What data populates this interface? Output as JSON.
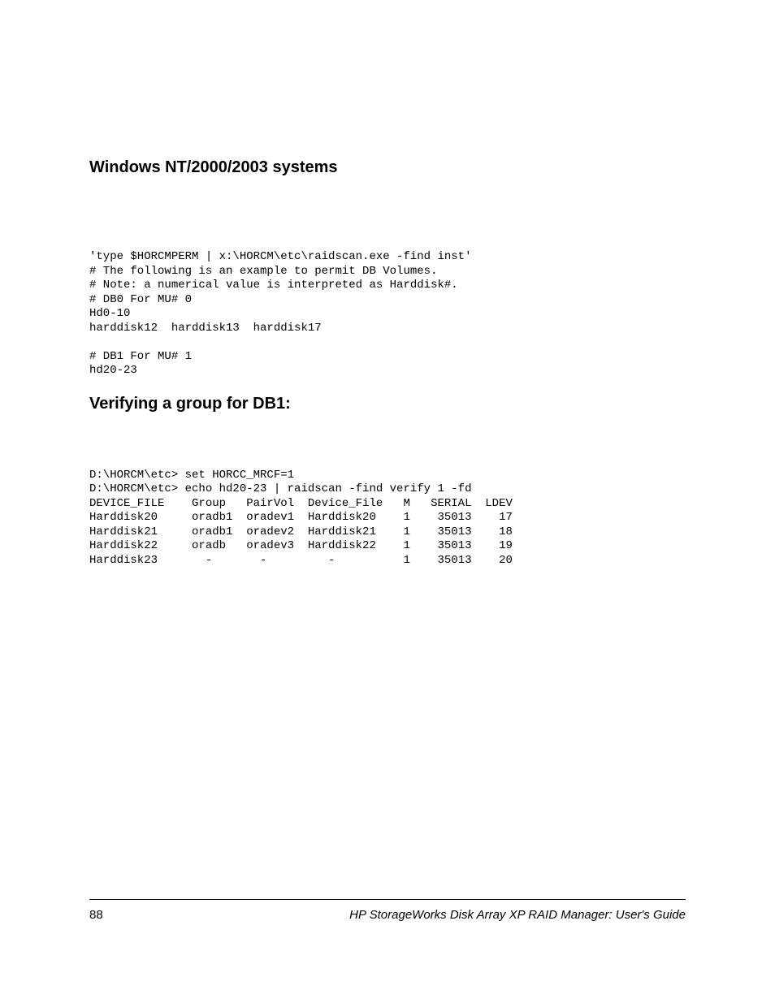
{
  "headings": {
    "h1": "Windows NT/2000/2003 systems",
    "h2": "Verifying a group for DB1:"
  },
  "code_block_1": "'type $HORCMPERM | x:\\HORCM\\etc\\raidscan.exe -find inst'\n# The following is an example to permit DB Volumes.\n# Note: a numerical value is interpreted as Harddisk#.\n# DB0 For MU# 0\nHd0-10\nharddisk12  harddisk13  harddisk17\n\n# DB1 For MU# 1\nhd20-23",
  "code_block_2": "D:\\HORCM\\etc> set HORCC_MRCF=1\nD:\\HORCM\\etc> echo hd20-23 | raidscan -find verify 1 -fd\nDEVICE_FILE    Group   PairVol  Device_File   M   SERIAL  LDEV\nHarddisk20     oradb1  oradev1  Harddisk20    1    35013    17\nHarddisk21     oradb1  oradev2  Harddisk21    1    35013    18\nHarddisk22     oradb   oradev3  Harddisk22    1    35013    19\nHarddisk23       -       -         -          1    35013    20",
  "footer": {
    "page_number": "88",
    "doc_title": "HP StorageWorks Disk Array XP RAID Manager: User's Guide"
  }
}
